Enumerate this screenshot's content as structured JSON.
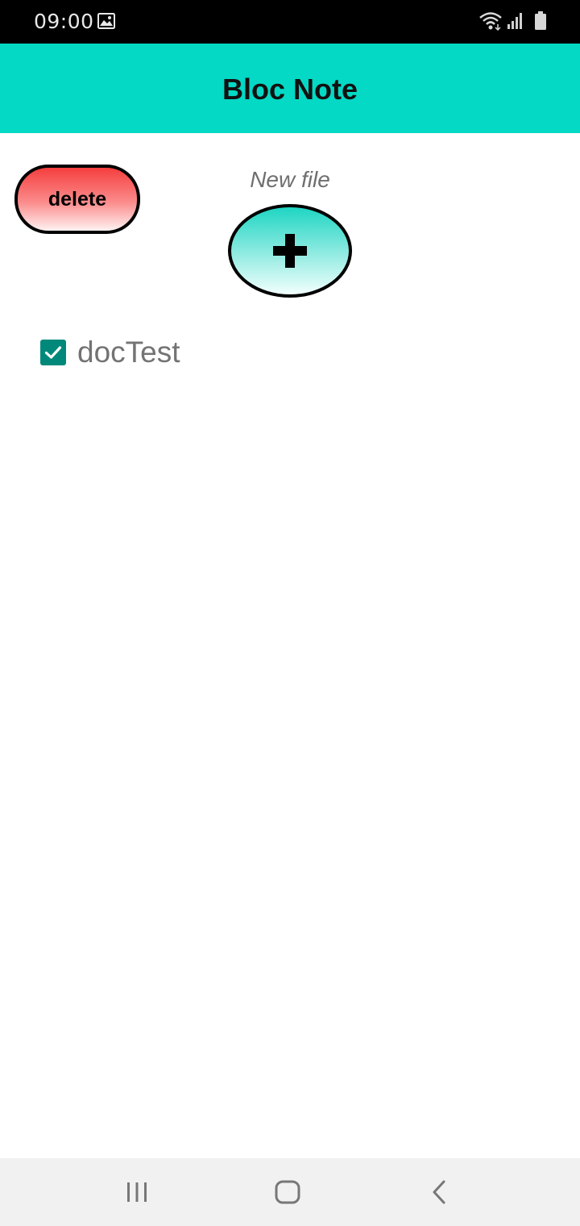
{
  "status_bar": {
    "time": "09:00",
    "icons": [
      "gallery-icon",
      "wifi-icon",
      "signal-icon",
      "battery-icon"
    ]
  },
  "app_bar": {
    "title": "Bloc Note",
    "background_color": "#03d9c5"
  },
  "actions": {
    "delete_label": "delete",
    "new_file_label": "New file",
    "add_icon": "plus-icon"
  },
  "files": [
    {
      "name": "docTest",
      "checked": true
    }
  ],
  "nav_bar": {
    "buttons": [
      "recents-icon",
      "home-icon",
      "back-icon"
    ]
  },
  "colors": {
    "accent": "#03d9c5",
    "delete": "#f53e3e",
    "checkbox": "#00897b"
  }
}
